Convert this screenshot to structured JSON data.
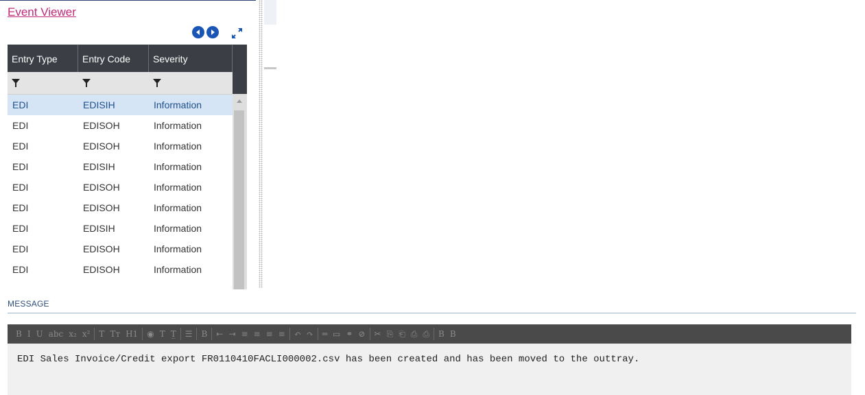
{
  "header": {
    "title": "Event Viewer"
  },
  "nav": {
    "prev": "circle-left-icon",
    "next": "circle-right-icon",
    "expand": "expand-icon"
  },
  "grid": {
    "columns": [
      "Entry Type",
      "Entry Code",
      "Severity"
    ],
    "rows": [
      [
        "EDI",
        "EDISIH",
        "Information"
      ],
      [
        "EDI",
        "EDISOH",
        "Information"
      ],
      [
        "EDI",
        "EDISOH",
        "Information"
      ],
      [
        "EDI",
        "EDISIH",
        "Information"
      ],
      [
        "EDI",
        "EDISOH",
        "Information"
      ],
      [
        "EDI",
        "EDISOH",
        "Information"
      ],
      [
        "EDI",
        "EDISIH",
        "Information"
      ],
      [
        "EDI",
        "EDISOH",
        "Information"
      ],
      [
        "EDI",
        "EDISOH",
        "Information"
      ]
    ],
    "selected_row": 0
  },
  "message": {
    "label": "MESSAGE",
    "text": "EDI Sales Invoice/Credit export FR0110410FACLI000002.csv has been created and has been moved to the outtray.",
    "toolbar": [
      "B",
      "I",
      "U",
      "abc",
      "x₂",
      "x²",
      "T",
      "Tт",
      "H1",
      "◉",
      "T",
      "T̲",
      "☰",
      "B",
      "⇤",
      "⇥",
      "≡",
      "≡",
      "≡",
      "≡",
      "↶",
      "↷",
      "═",
      "▭",
      "⚭",
      "⊘",
      "✂",
      "⎘",
      "⎗",
      "⎙",
      "⎙",
      "B",
      "B"
    ]
  },
  "colors": {
    "accent": "#c0297a",
    "header_bg": "#3b3e45",
    "selected_bg": "#d5e5f6",
    "nav_blue": "#1a56b5"
  }
}
